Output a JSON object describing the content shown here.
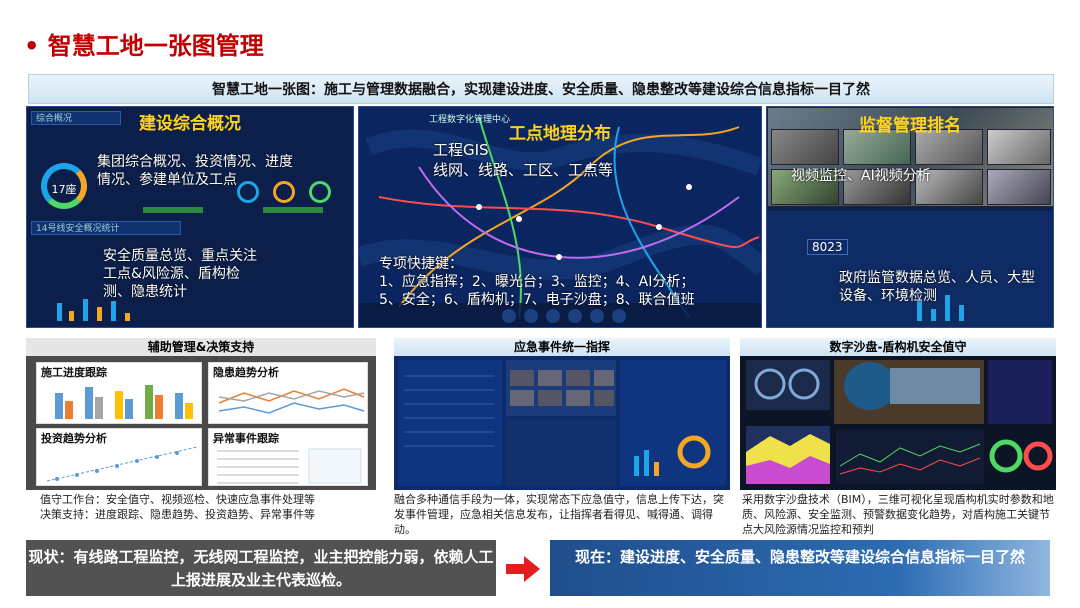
{
  "page": {
    "title": "• 智慧工地一张图管理",
    "banner": "智慧工地一张图：施工与管理数据融合，实现建设进度、安全质量、隐患整改等建设综合信息指标一目了然"
  },
  "panel_overview": {
    "heading": "建设综合概况",
    "text1": "集团综合概况、投资情况、进度情况、参建单位及工点",
    "text2": "安全质量总览、重点关注工点&风险源、盾构检测、隐患统计",
    "ring_label": "17座",
    "mini_title1": "综合概况",
    "mini_title2": "14号线安全概况统计"
  },
  "panel_map": {
    "heading": "工点地理分布",
    "text1": "工程GIS",
    "text2": "线网、线路、工区、工点等",
    "text3": "专项快捷键：",
    "text4": "1、应急指挥；2、曝光台；3、监控；4、AI分析；",
    "text5": "5、安全；6、盾构机；7、电子沙盘；8、联合值班",
    "screen_title": "工程数字化管理中心"
  },
  "panel_supervise": {
    "heading": "监督管理排名",
    "text1": "视频监控、AI视频分析",
    "text2": "政府监管数据总览、人员、大型设备、环境检测",
    "counter": "8023"
  },
  "aux": {
    "heading": "辅助管理&决策支持",
    "card1": "施工进度跟踪",
    "card2": "隐患趋势分析",
    "card3": "投资趋势分析",
    "card4": "异常事件跟踪",
    "caption_line1": "值守工作台：安全值守、视频巡检、快速应急事件处理等",
    "caption_line2": "决策支持：进度跟踪、隐患趋势、投资趋势、异常事件等"
  },
  "emergency": {
    "heading": "应急事件统一指挥",
    "caption": "融合多种通信手段为一体，实现常态下应急值守，信息上传下达，突发事件管理，应急相关信息发布，让指挥者看得见、喊得通、调得动。"
  },
  "sandbox": {
    "heading": "数字沙盘-盾构机安全值守",
    "caption": "采用数字沙盘技术（BIM），三维可视化呈现盾构机实时参数和地质、风险源、安全监测、预警数据变化趋势，对盾构施工关键节点大风险源情况监控和预判"
  },
  "status": {
    "now": "现状：有线路工程监控，无线网工程监控，业主把控能力弱，依赖人工上报进展及业主代表巡检。",
    "future": "现在：建设进度、安全质量、隐患整改等建设综合信息指标一目了然"
  },
  "colors": {
    "title_red": "#c00000",
    "heading_yellow": "#ffd21f",
    "arrow_red": "#e02020"
  }
}
